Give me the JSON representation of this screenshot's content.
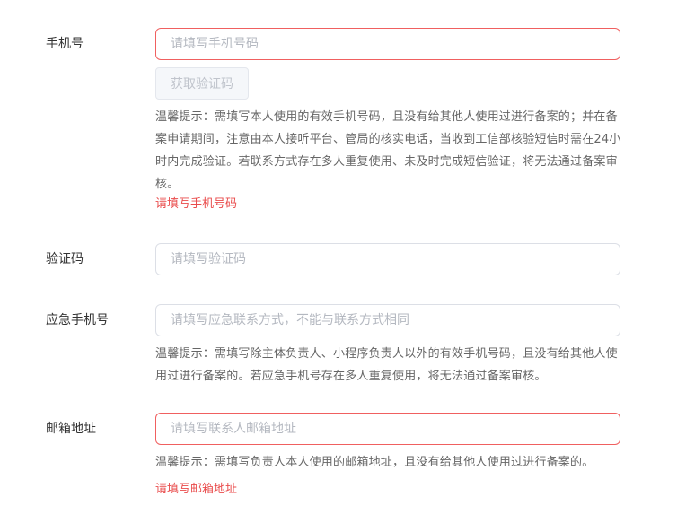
{
  "phone": {
    "label": "手机号",
    "placeholder": "请填写手机号码",
    "value": "",
    "code_button": "获取验证码",
    "tip": "温馨提示：需填写本人使用的有效手机号码，且没有给其他人使用过进行备案的；并在备案申请期间，注意由本人接听平台、管局的核实电话，当收到工信部核验短信时需在24小时内完成验证。若联系方式存在多人重复使用、未及时完成短信验证，将无法通过备案审核。",
    "error": "请填写手机号码"
  },
  "code": {
    "label": "验证码",
    "placeholder": "请填写验证码",
    "value": ""
  },
  "emergency_phone": {
    "label": "应急手机号",
    "placeholder": "请填写应急联系方式，不能与联系方式相同",
    "value": "",
    "tip": "温馨提示：需填写除主体负责人、小程序负责人以外的有效手机号码，且没有给其他人使用过进行备案的。若应急手机号存在多人重复使用，将无法通过备案审核。"
  },
  "email": {
    "label": "邮箱地址",
    "placeholder": "请填写联系人邮箱地址",
    "value": "",
    "tip": "温馨提示：需填写负责人本人使用的邮箱地址，且没有给其他人使用过进行备案的。",
    "error": "请填写邮箱地址"
  },
  "colors": {
    "error": "#e94b4b",
    "error_border": "#f06060",
    "border": "#dcdfe6",
    "hint_text": "#666666"
  }
}
